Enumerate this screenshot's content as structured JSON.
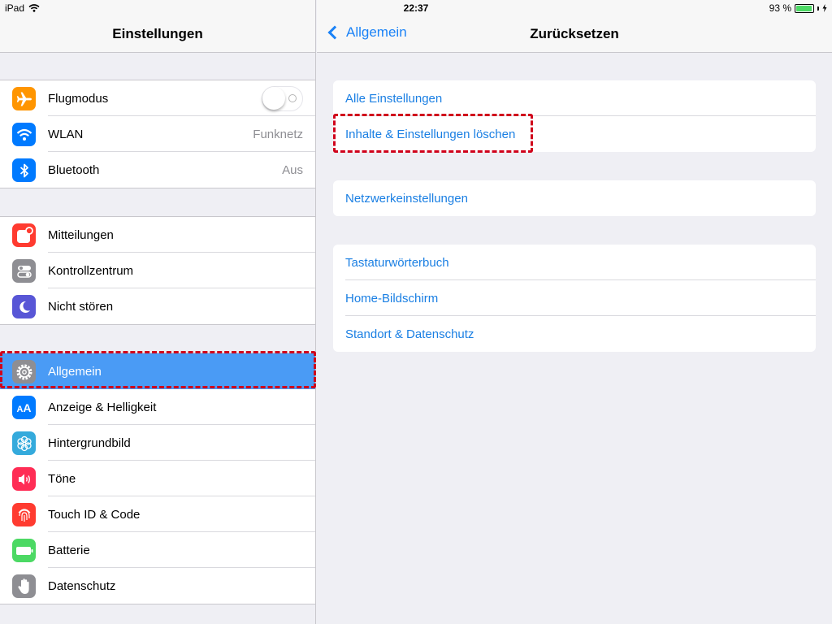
{
  "status_bar": {
    "device": "iPad",
    "time": "22:37",
    "battery": "93 %"
  },
  "master": {
    "title": "Einstellungen",
    "groups": [
      [
        {
          "label": "Flugmodus",
          "icon": "airplane-icon",
          "color": "#ff9500",
          "toggle": false
        },
        {
          "label": "WLAN",
          "icon": "wifi-icon",
          "color": "#007aff",
          "value": "Funknetz"
        },
        {
          "label": "Bluetooth",
          "icon": "bluetooth-icon",
          "color": "#007aff",
          "value": "Aus"
        }
      ],
      [
        {
          "label": "Mitteilungen",
          "icon": "notifications-icon",
          "color": "#ff3b30"
        },
        {
          "label": "Kontrollzentrum",
          "icon": "control-center-icon",
          "color": "#8e8e93"
        },
        {
          "label": "Nicht stören",
          "icon": "moon-icon",
          "color": "#5856d6"
        }
      ],
      [
        {
          "label": "Allgemein",
          "icon": "gear-icon",
          "color": "#8e8e93",
          "selected": true
        },
        {
          "label": "Anzeige & Helligkeit",
          "icon": "display-icon",
          "color": "#007aff"
        },
        {
          "label": "Hintergrundbild",
          "icon": "wallpaper-icon",
          "color": "#34aadc"
        },
        {
          "label": "Töne",
          "icon": "speaker-icon",
          "color": "#ff2d55"
        },
        {
          "label": "Touch ID & Code",
          "icon": "fingerprint-icon",
          "color": "#ff3b30"
        },
        {
          "label": "Batterie",
          "icon": "battery-icon",
          "color": "#4cd964"
        },
        {
          "label": "Datenschutz",
          "icon": "hand-icon",
          "color": "#8e8e93"
        }
      ]
    ]
  },
  "detail": {
    "back_label": "Allgemein",
    "title": "Zurücksetzen",
    "groups": [
      [
        "Alle Einstellungen",
        "Inhalte & Einstellungen löschen"
      ],
      [
        "Netzwerkeinstellungen"
      ],
      [
        "Tastaturwörterbuch",
        "Home-Bildschirm",
        "Standort & Datenschutz"
      ]
    ]
  },
  "colors": {
    "accent": "#1a82f7",
    "selection": "#4a9bf5",
    "highlight": "#d0021b"
  }
}
